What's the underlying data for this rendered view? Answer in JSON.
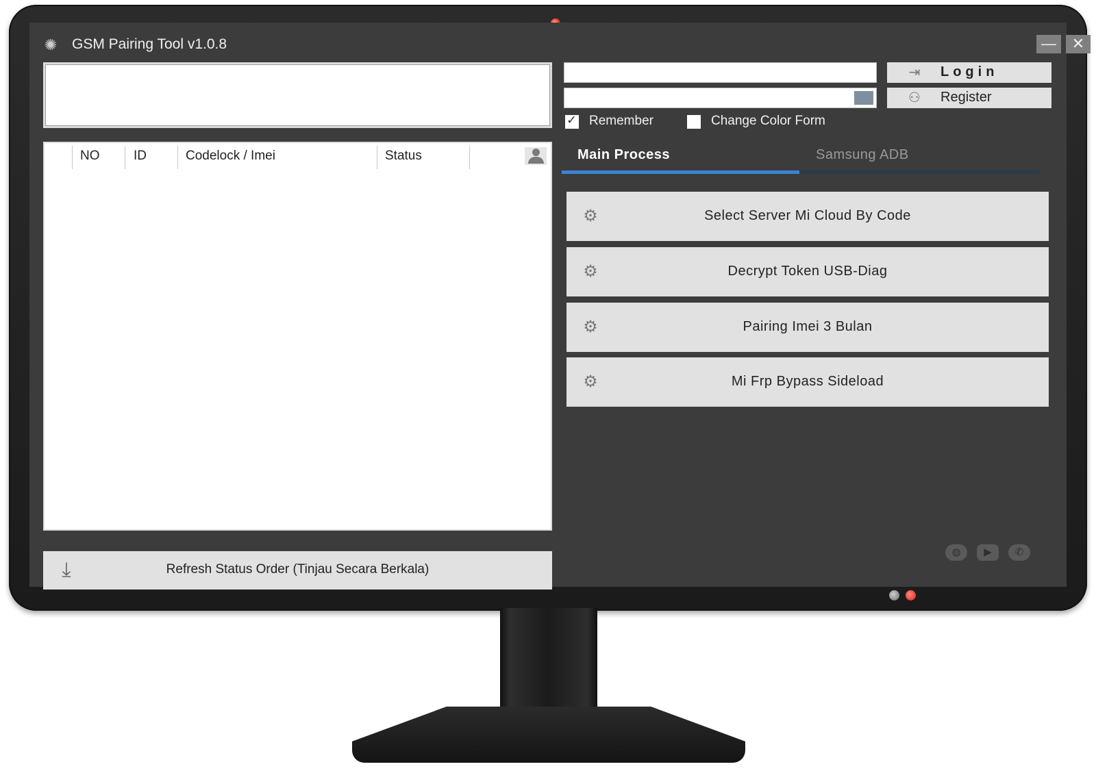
{
  "window": {
    "title": "GSM Pairing Tool  v1.0.8",
    "minimize_glyph": "—",
    "close_glyph": "✕"
  },
  "orders_table": {
    "columns": [
      "NO",
      "ID",
      "Codelock / Imei",
      "Status"
    ],
    "rows": []
  },
  "refresh_button": {
    "label": "Refresh Status Order (Tinjau Secara Berkala)"
  },
  "auth": {
    "username_value": "",
    "password_value": "",
    "login_label": "Login",
    "register_label": "Register",
    "remember_label": "Remember",
    "remember_checked": true,
    "change_color_label": "Change Color Form",
    "change_color_checked": false
  },
  "tabs": [
    {
      "label": "Main Process",
      "active": true
    },
    {
      "label": "Samsung ADB",
      "active": false
    }
  ],
  "actions": [
    {
      "label": "Select Server Mi Cloud By Code"
    },
    {
      "label": "Decrypt Token USB-Diag"
    },
    {
      "label": "Pairing Imei 3 Bulan"
    },
    {
      "label": "Mi Frp Bypass Sideload"
    }
  ],
  "social_icons": [
    "globe-icon",
    "youtube-icon",
    "whatsapp-icon"
  ],
  "colors": {
    "window_bg": "#3c3c3c",
    "tab_active_accent": "#3a84d8",
    "button_bg": "#e1e1e1"
  }
}
